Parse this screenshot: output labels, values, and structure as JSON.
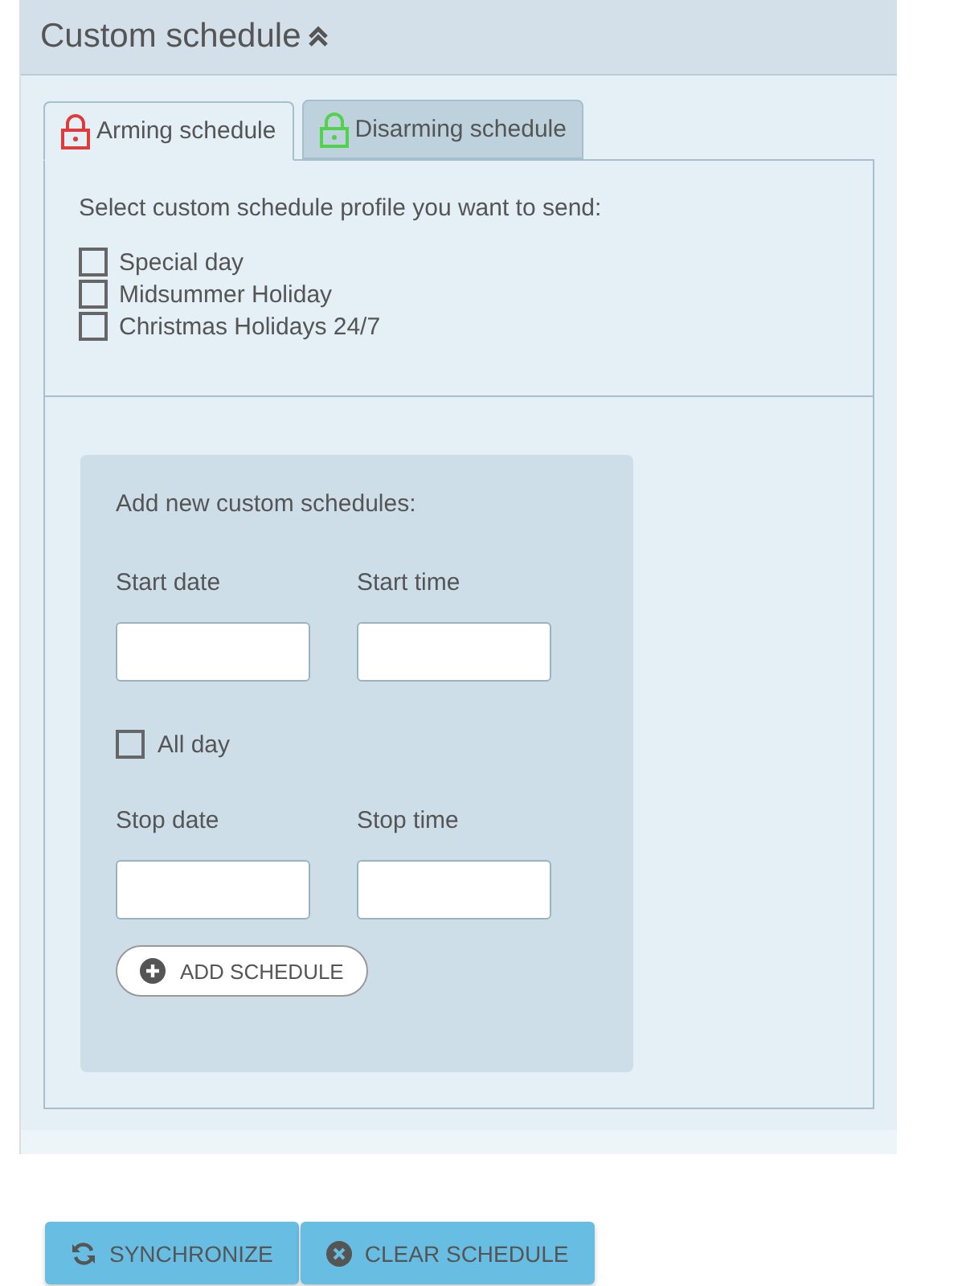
{
  "header": {
    "title": "Custom schedule"
  },
  "tabs": [
    {
      "label": "Arming schedule",
      "kind": "arm",
      "selected": true
    },
    {
      "label": "Disarming schedule",
      "kind": "disarm",
      "selected": false
    }
  ],
  "profiles": {
    "prompt": "Select custom schedule profile you want to send:",
    "items": [
      {
        "label": "Special day",
        "checked": false
      },
      {
        "label": "Midsummer Holiday",
        "checked": false
      },
      {
        "label": "Christmas Holidays 24/7",
        "checked": false
      }
    ]
  },
  "form": {
    "title": "Add new custom schedules:",
    "start_date": {
      "label": "Start date"
    },
    "start_time": {
      "label": "Start time"
    },
    "all_day": {
      "label": "All day",
      "checked": false
    },
    "stop_date": {
      "label": "Stop date"
    },
    "stop_time": {
      "label": "Stop time"
    },
    "add_button": "ADD SCHEDULE"
  },
  "actions": [
    {
      "label": "SYNCHRONIZE",
      "kind": "sync"
    },
    {
      "label": "CLEAR SCHEDULE",
      "kind": "clear"
    }
  ]
}
